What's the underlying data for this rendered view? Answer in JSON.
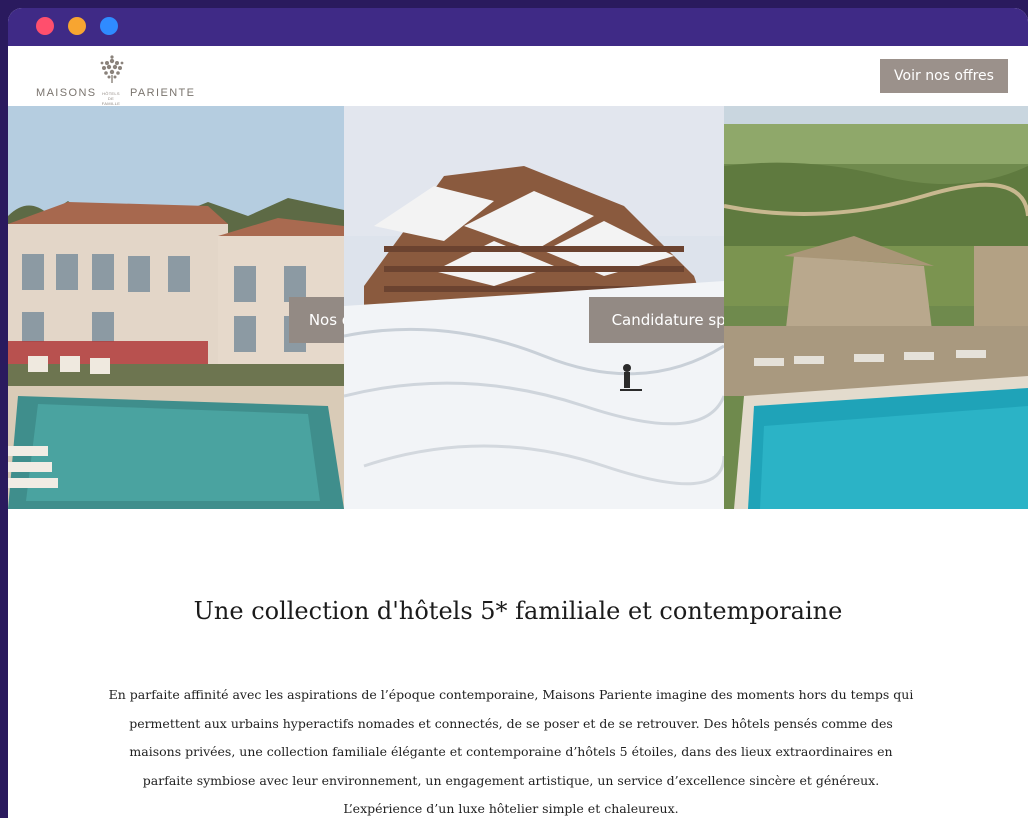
{
  "brand": {
    "name_left": "MAISONS",
    "name_right": "PARIENTE",
    "tagline": "HÔTELS DE FAMILLE",
    "logo_icon": "flower-tree-icon"
  },
  "header": {
    "cta_label": "Voir nos offres"
  },
  "hero": {
    "panels": [
      "hotel-pool-provence-image",
      "chalet-ski-slope-image",
      "vineyard-pool-image"
    ],
    "button_offers": "Nos offres",
    "button_application": "Candidature spontanée"
  },
  "content": {
    "headline": "Une collection d'hôtels 5* familiale et contemporaine",
    "paragraph": "En parfaite affinité avec les aspirations de l’époque contemporaine, Maisons Pariente imagine des moments hors du temps qui permettent aux urbains hyperactifs nomades et connectés, de se poser et de se retrouver. Des hôtels pensés comme des maisons privées, une collection familiale élégante et contemporaine d’hôtels 5 étoiles, dans des lieux extraordinaires en parfaite symbiose avec leur environnement, un engagement artistique, un service d’excellence sincère et généreux. L’expérience d’un luxe hôtelier simple et chaleureux."
  },
  "colors": {
    "page_background": "#2a1a5e",
    "titlebar": "#3f2a86",
    "button": "#938a84",
    "dot_red": "#ff4f6d",
    "dot_yellow": "#f7a531",
    "dot_blue": "#2f8bff"
  }
}
